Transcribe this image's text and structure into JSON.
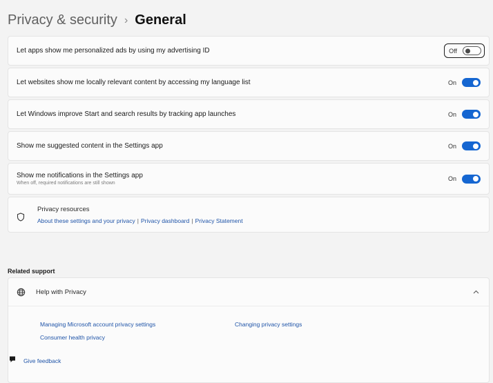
{
  "breadcrumb": {
    "parent": "Privacy & security",
    "separator": "›",
    "current": "General"
  },
  "settings": [
    {
      "label": "Let apps show me personalized ads by using my advertising ID",
      "description": "",
      "state": "Off",
      "on": false
    },
    {
      "label": "Let websites show me locally relevant content by accessing my language list",
      "description": "",
      "state": "On",
      "on": true
    },
    {
      "label": "Let Windows improve Start and search results by tracking app launches",
      "description": "",
      "state": "On",
      "on": true
    },
    {
      "label": "Show me suggested content in the Settings app",
      "description": "",
      "state": "On",
      "on": true
    },
    {
      "label": "Show me notifications in the Settings app",
      "description": "When off, required notifications are still shown",
      "state": "On",
      "on": true
    }
  ],
  "resources": {
    "title": "Privacy resources",
    "links": [
      "About these settings and your privacy",
      "Privacy dashboard",
      "Privacy Statement"
    ],
    "divider": "|"
  },
  "related_support": {
    "heading": "Related support",
    "help": {
      "title": "Help with Privacy",
      "links": [
        "Managing Microsoft account privacy settings",
        "Changing privacy settings",
        "Consumer health privacy"
      ]
    }
  },
  "feedback": {
    "label": "Give feedback"
  },
  "colors": {
    "accent": "#1566d1",
    "link": "#1f54a8",
    "background": "#f3f3f3",
    "card": "#fbfbfb"
  },
  "icons": [
    "shield-icon",
    "globe-help-icon",
    "chevron-up-icon",
    "feedback-icon"
  ]
}
